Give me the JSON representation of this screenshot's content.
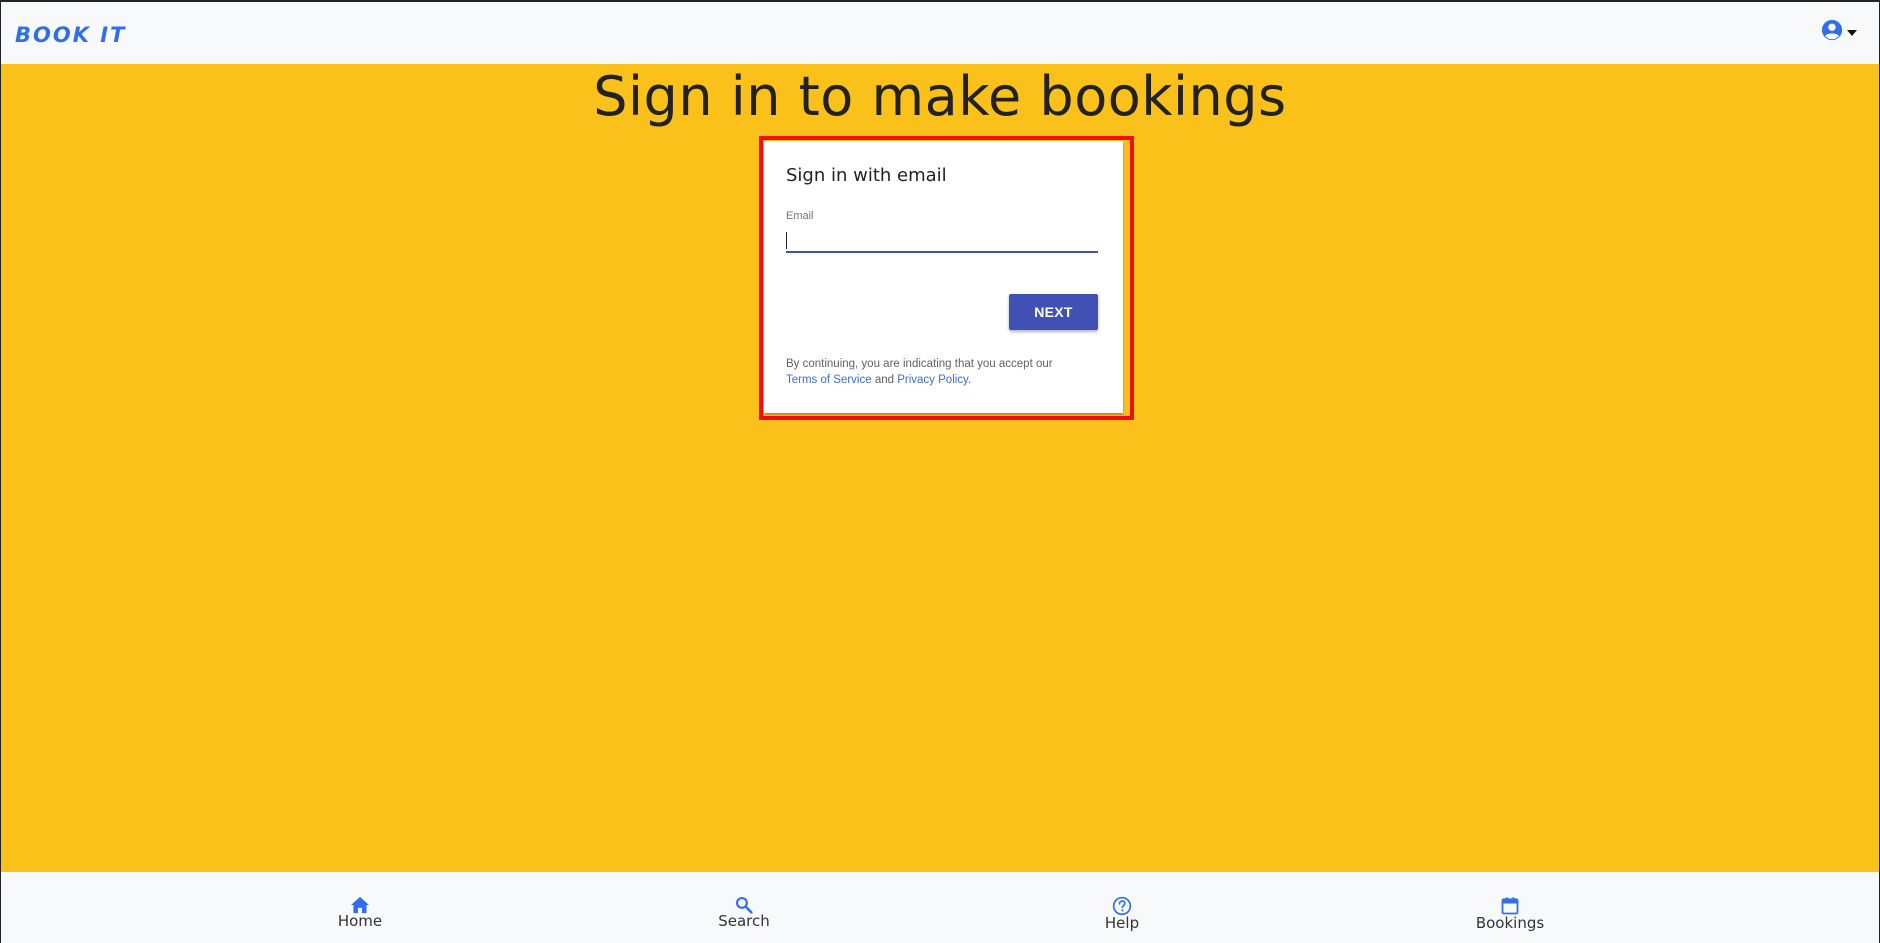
{
  "header": {
    "brand": "BOOK IT",
    "account_icon": "account-circle-icon"
  },
  "main": {
    "title": "Sign in to make bookings"
  },
  "signin_card": {
    "title": "Sign in with email",
    "email_label": "Email",
    "email_value": "",
    "next_label": "NEXT",
    "legal_prefix": "By continuing, you are indicating that you accept our",
    "terms_link": "Terms of Service",
    "and": "and",
    "privacy_link": "Privacy Policy",
    "period": "."
  },
  "bottom_nav": {
    "items": [
      {
        "label": "Home",
        "icon": "home-icon"
      },
      {
        "label": "Search",
        "icon": "search-icon"
      },
      {
        "label": "Help",
        "icon": "help-icon"
      },
      {
        "label": "Bookings",
        "icon": "calendar-icon"
      }
    ]
  },
  "colors": {
    "background": "#fbc11b",
    "bars": "#f8f9fa",
    "brand": "#2f6fe8",
    "primary_button": "#3f51b5",
    "highlight": "#f00f0f"
  }
}
